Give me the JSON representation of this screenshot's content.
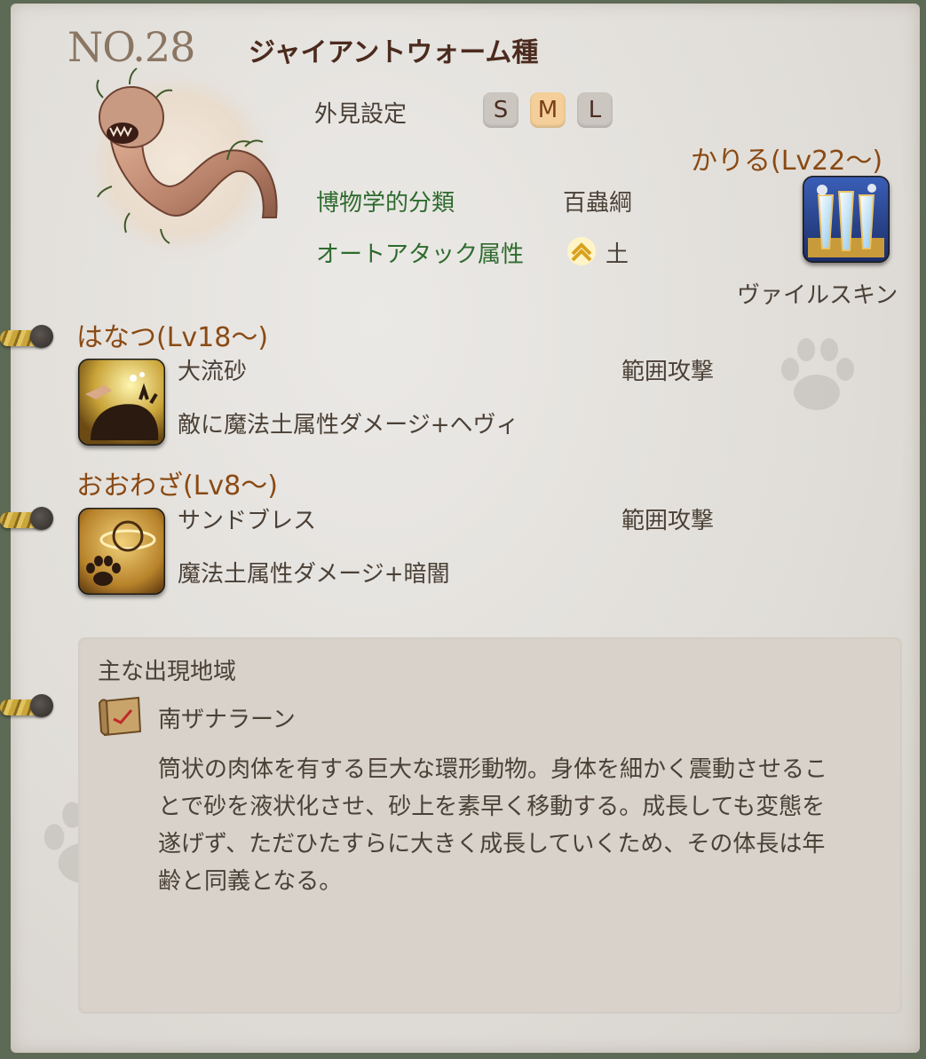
{
  "header": {
    "number": "NO.28",
    "name": "ジャイアントウォーム種"
  },
  "appearance": {
    "label": "外見設定",
    "sizes": [
      "S",
      "M",
      "L"
    ],
    "selected": "M"
  },
  "classification": {
    "label": "博物学的分類",
    "value": "百蟲綱"
  },
  "auto_attack": {
    "label": "オートアタック属性",
    "value": "土",
    "icon": "earth-element-icon"
  },
  "kariru": {
    "heading": "かりる(Lv22～)",
    "skill_name": "ヴァイルスキン",
    "icon": "vile-skin-icon"
  },
  "hanatsu": {
    "heading": "はなつ(Lv18～)",
    "skill_name": "大流砂",
    "range": "範囲攻撃",
    "effect": "敵に魔法土属性ダメージ+ヘヴィ",
    "icon": "quicksand-icon"
  },
  "oowaza": {
    "heading": "おおわざ(Lv8～)",
    "skill_name": "サンドブレス",
    "range": "範囲攻撃",
    "effect": "魔法土属性ダメージ+暗闇",
    "icon": "sand-breath-icon"
  },
  "habitat": {
    "label": "主な出現地域",
    "region": "南ザナラーン",
    "icon": "map-scroll-icon",
    "description_lines": [
      "筒状の肉体を有する巨大な環形動物。身体を細かく震動させるこ",
      "とで砂を液状化させ、砂上を素早く移動する。成長しても変態を",
      "遂げず、ただひたすらに大きく成長していくため、その体長は年",
      "齢と同義となる。"
    ]
  },
  "colors": {
    "page_bg": "#e3e0dc",
    "heading_brown": "#8a4a14",
    "label_green": "#2e6b2e",
    "title_dark": "#4b2b1e",
    "size_selected": "#f4cf9a"
  }
}
